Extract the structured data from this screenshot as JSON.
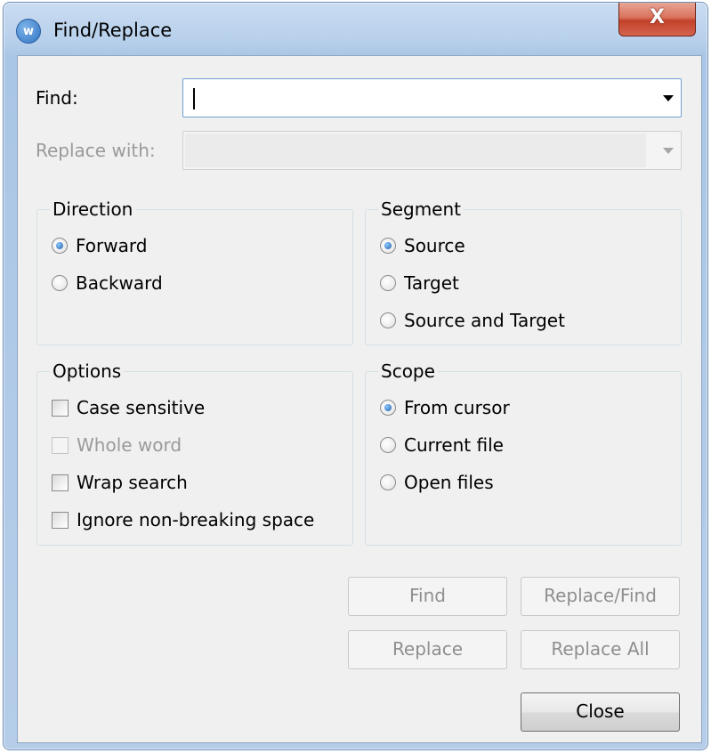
{
  "window": {
    "title": "Find/Replace",
    "app_icon": "app-logo-icon",
    "app_icon_letter": "w",
    "close_glyph": "X"
  },
  "find": {
    "label": "Find:",
    "value": ""
  },
  "replace": {
    "label": "Replace with:",
    "value": "",
    "disabled": true
  },
  "direction": {
    "title": "Direction",
    "options": [
      {
        "label": "Forward",
        "selected": true
      },
      {
        "label": "Backward",
        "selected": false
      }
    ]
  },
  "segment": {
    "title": "Segment",
    "options": [
      {
        "label": "Source",
        "selected": true
      },
      {
        "label": "Target",
        "selected": false
      },
      {
        "label": "Source and Target",
        "selected": false
      }
    ]
  },
  "options": {
    "title": "Options",
    "items": [
      {
        "label": "Case sensitive",
        "checked": false,
        "disabled": false
      },
      {
        "label": "Whole word",
        "checked": false,
        "disabled": true
      },
      {
        "label": "Wrap search",
        "checked": false,
        "disabled": false
      },
      {
        "label": "Ignore non-breaking space",
        "checked": false,
        "disabled": false
      }
    ]
  },
  "scope": {
    "title": "Scope",
    "options": [
      {
        "label": "From cursor",
        "selected": true
      },
      {
        "label": "Current file",
        "selected": false
      },
      {
        "label": "Open files",
        "selected": false
      }
    ]
  },
  "buttons": {
    "find": "Find",
    "replace_find": "Replace/Find",
    "replace": "Replace",
    "replace_all": "Replace All",
    "close": "Close"
  }
}
